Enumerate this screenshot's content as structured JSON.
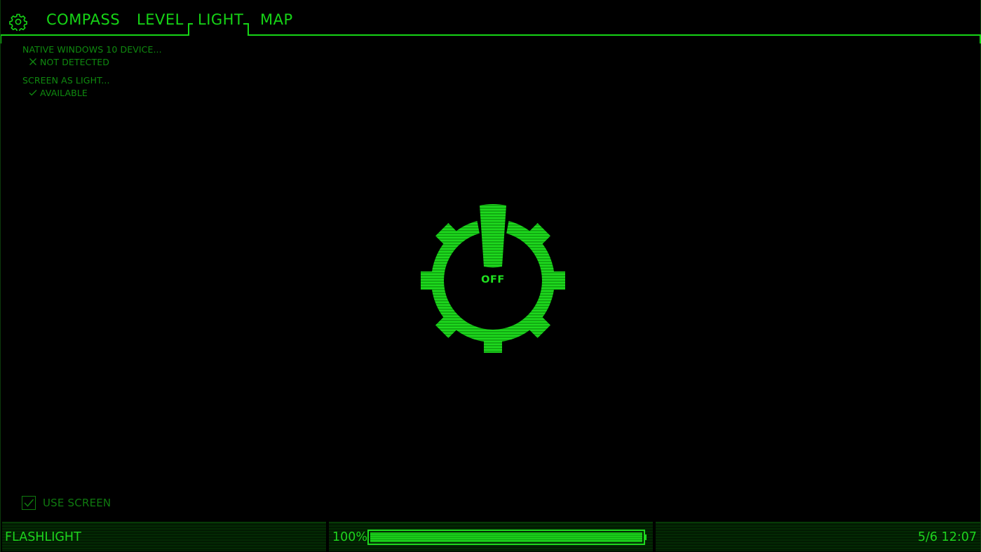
{
  "nav": {
    "settings_icon": "gear-icon",
    "tabs": [
      {
        "id": "compass",
        "label": "COMPASS"
      },
      {
        "id": "level",
        "label": "LEVEL"
      },
      {
        "id": "light",
        "label": "LIGHT",
        "active": true
      },
      {
        "id": "map",
        "label": "MAP"
      }
    ]
  },
  "status": {
    "native_title": "NATIVE WINDOWS 10 DEVICE...",
    "native_value": "NOT DETECTED",
    "native_icon": "x-icon",
    "screen_title": "SCREEN AS LIGHT...",
    "screen_value": "AVAILABLE",
    "screen_icon": "check-icon"
  },
  "power": {
    "state_label": "OFF",
    "icon": "power-gear-icon"
  },
  "use_screen": {
    "label": "USE SCREEN",
    "checked": true
  },
  "footer": {
    "mode": "FLASHLIGHT",
    "battery_text": "100%",
    "battery_level": 1.0,
    "clock": "5/6 12:07"
  },
  "colors": {
    "accent": "#16d416",
    "dim": "#0f8a0f",
    "background": "#000000"
  }
}
